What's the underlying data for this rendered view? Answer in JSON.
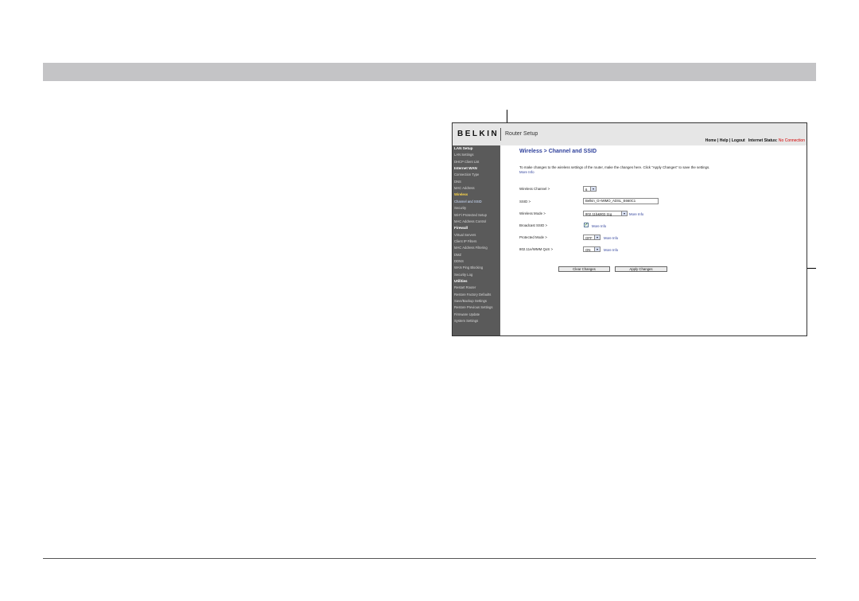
{
  "router": {
    "logo": "BELKIN",
    "app_title": "Router Setup",
    "top_links": {
      "home": "Home",
      "sep1": "|",
      "help": "Help",
      "sep2": "|",
      "logout": "Logout",
      "status_label": "Internet Status:",
      "status_value": "No Connection"
    },
    "sidebar": [
      {
        "label": "LAN Setup",
        "kind": "head"
      },
      {
        "label": "LAN Settings",
        "kind": "item"
      },
      {
        "label": "DHCP Client List",
        "kind": "item"
      },
      {
        "label": "Internet WAN",
        "kind": "head"
      },
      {
        "label": "Connection Type",
        "kind": "item"
      },
      {
        "label": "DNS",
        "kind": "item"
      },
      {
        "label": "MAC Address",
        "kind": "item"
      },
      {
        "label": "Wireless",
        "kind": "hl"
      },
      {
        "label": "Channel and SSID",
        "kind": "active"
      },
      {
        "label": "Security",
        "kind": "item"
      },
      {
        "label": "Wi-Fi Protected Setup",
        "kind": "item"
      },
      {
        "label": "MAC Address Control",
        "kind": "item"
      },
      {
        "label": "Firewall",
        "kind": "head"
      },
      {
        "label": "Virtual Servers",
        "kind": "item"
      },
      {
        "label": "Client IP Filters",
        "kind": "item"
      },
      {
        "label": "MAC Address Filtering",
        "kind": "item"
      },
      {
        "label": "DMZ",
        "kind": "item"
      },
      {
        "label": "DDNS",
        "kind": "item"
      },
      {
        "label": "WAN Ping Blocking",
        "kind": "item"
      },
      {
        "label": "Security Log",
        "kind": "item"
      },
      {
        "label": "Utilities",
        "kind": "head"
      },
      {
        "label": "Restart Router",
        "kind": "item"
      },
      {
        "label": "Restore Factory Defaults",
        "kind": "item"
      },
      {
        "label": "Save/Backup Settings",
        "kind": "item"
      },
      {
        "label": "Restore Previous Settings",
        "kind": "item"
      },
      {
        "label": "Firmware Update",
        "kind": "item"
      },
      {
        "label": "System Settings",
        "kind": "item"
      }
    ],
    "main": {
      "title": "Wireless > Channel and SSID",
      "intro": "To make changes to the wireless settings of the router, make the changes here. Click \"Apply Changes\" to save the settings.",
      "intro_more": "More Info",
      "channel": {
        "label": "Wireless Channel >",
        "value": "6"
      },
      "ssid": {
        "label": "SSID >",
        "value": "Belkin_G+MIMO_ADSL_E660C1"
      },
      "mode": {
        "label": "Wireless Mode >",
        "value": "802.11b&802.11g",
        "more": "More Info"
      },
      "broadcast": {
        "label": "Broadcast SSID >",
        "checked": true,
        "more": "More Info"
      },
      "protected": {
        "label": "Protected Mode >",
        "value": "OFF",
        "more": "More Info"
      },
      "qos": {
        "label": "802.11e/WMM QoS >",
        "value": "ON",
        "more": "More Info"
      },
      "clear_label": "Clear Changes",
      "apply_label": "Apply Changes"
    }
  }
}
